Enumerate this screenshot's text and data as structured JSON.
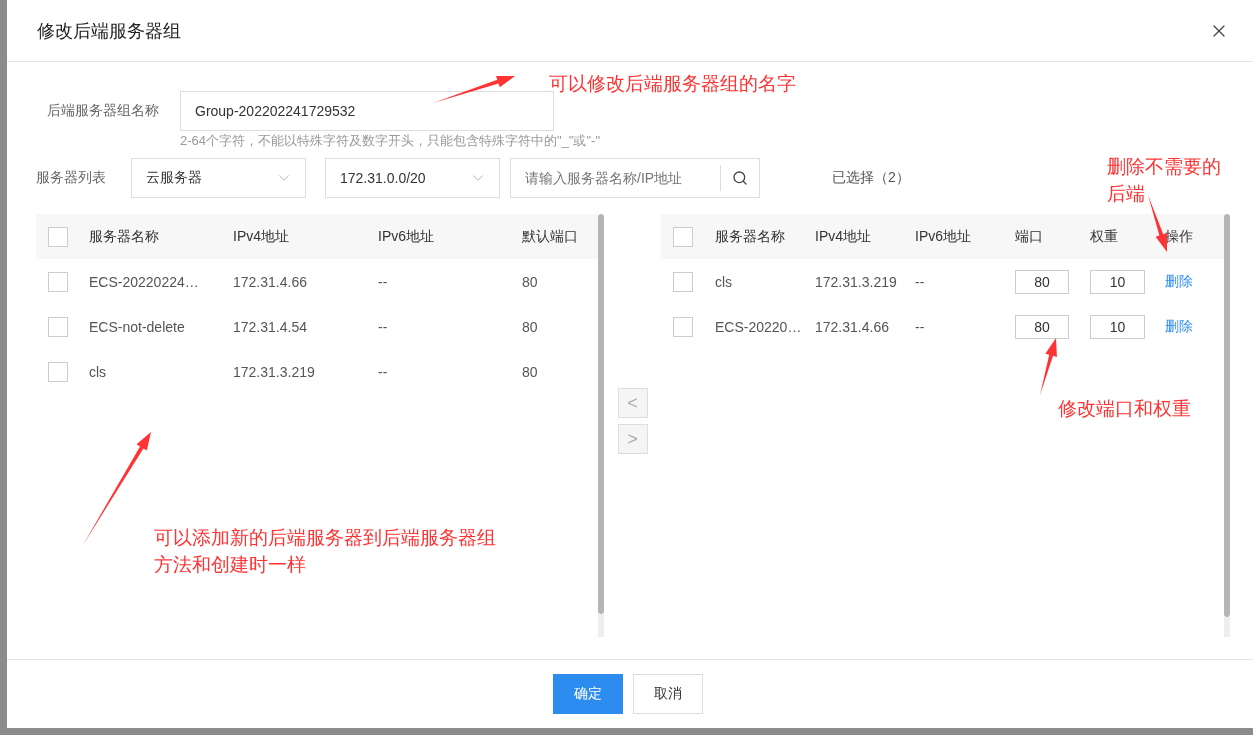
{
  "dialog": {
    "title": "修改后端服务器组"
  },
  "name_field": {
    "label": "后端服务器组名称",
    "value": "Group-202202241729532",
    "hint": "2-64个字符，不能以特殊字符及数字开头，只能包含特殊字符中的\"_\"或\"-\""
  },
  "server_list": {
    "label": "服务器列表",
    "type_select": "云服务器",
    "subnet_select": "172.31.0.0/20",
    "search": {
      "placeholder": "请输入服务器名称/IP地址"
    },
    "selected_count": "已选择（2）"
  },
  "available": {
    "columns": [
      "服务器名称",
      "IPv4地址",
      "IPv6地址",
      "默认端口"
    ],
    "header_checked": false,
    "rows": [
      {
        "checked": false,
        "cells": [
          "ECS-20220224…",
          "172.31.4.66",
          "--",
          "80"
        ]
      },
      {
        "checked": false,
        "cells": [
          "ECS-not-delete",
          "172.31.4.54",
          "--",
          "80"
        ]
      },
      {
        "checked": false,
        "cells": [
          "cls",
          "172.31.3.219",
          "--",
          "80"
        ]
      }
    ]
  },
  "transfer": {
    "buttons": [
      "<",
      ">"
    ]
  },
  "selected": {
    "columns": [
      "服务器名称",
      "IPv4地址",
      "IPv6地址",
      "端口",
      "权重",
      "操作"
    ],
    "header_checked": false,
    "rows": [
      {
        "checked": false,
        "name": "cls",
        "ipv4": "172.31.3.219",
        "ipv6": "--",
        "port": "80",
        "weight": "10",
        "action": "删除"
      },
      {
        "checked": false,
        "name": "ECS-20220…",
        "ipv4": "172.31.4.66",
        "ipv6": "--",
        "port": "80",
        "weight": "10",
        "action": "删除"
      }
    ]
  },
  "footer": {
    "buttons": [
      {
        "label": "确定",
        "kind": "primary"
      },
      {
        "label": "取消",
        "kind": "default"
      }
    ]
  },
  "annotations": [
    {
      "lines": [
        "可以修改后端服务器组的名字"
      ]
    },
    {
      "lines": [
        "删除不需要的",
        "后端"
      ]
    },
    {
      "lines": [
        "修改端口和权重"
      ]
    },
    {
      "lines": [
        "可以添加新的后端服务器到后端服务器组",
        "方法和创建时一样"
      ]
    }
  ]
}
